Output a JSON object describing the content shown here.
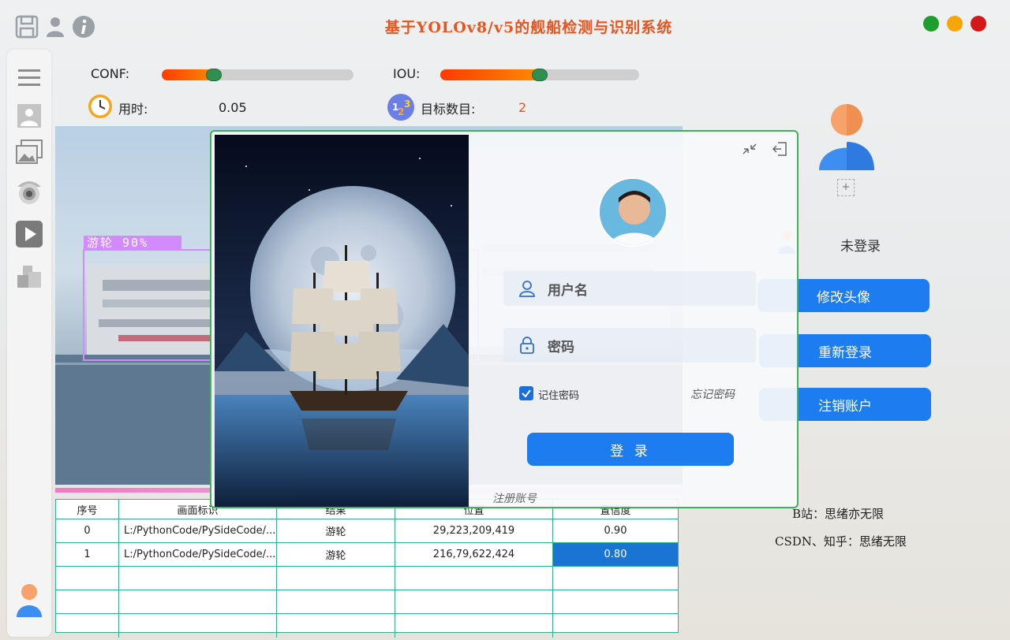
{
  "app": {
    "title": "基于YOLOv8/v5的舰船检测与识别系统",
    "colors": {
      "title": "#e8541e",
      "accent": "#1e7cf1",
      "green": "#1e9e2c",
      "orange": "#f6a609",
      "red": "#d21818"
    }
  },
  "toolbar": {
    "icons": [
      "save-icon",
      "user-icon",
      "info-icon"
    ]
  },
  "sidebar": {
    "items": [
      "menu-icon",
      "image-icon",
      "images-folder-icon",
      "camera-icon",
      "video-play-icon",
      "model-cube-icon",
      "avatar-icon"
    ]
  },
  "params": {
    "conf_label": "CONF:",
    "conf_value": 0.27,
    "iou_label": "IOU:",
    "iou_value": 0.5,
    "time_label": "用时:",
    "time_value": "0.05",
    "count_label": "目标数目:",
    "count_value": "2"
  },
  "detection": {
    "label": "游轮 90%"
  },
  "table": {
    "headers": [
      "序号",
      "画面标识",
      "结果",
      "位置",
      "置信度"
    ],
    "rows": [
      [
        "0",
        "L:/PythonCode/PySideCode/...",
        "游轮",
        "29,223,209,419",
        "0.90"
      ],
      [
        "1",
        "L:/PythonCode/PySideCode/...",
        "游轮",
        "216,79,622,424",
        "0.80"
      ]
    ],
    "empty_rows": 3
  },
  "right_panel": {
    "status": "未登录",
    "plus": "+",
    "change_avatar": "修改头像",
    "relogin": "重新登录",
    "cancel_account": "注销账户",
    "credit1": "B站：思绪亦无限",
    "credit2": "CSDN、知乎：思绪无限"
  },
  "login": {
    "username_placeholder": "用户名",
    "password_placeholder": "密码",
    "remember_label": "记住密码",
    "remember_checked": true,
    "forgot_label": "忘记密码",
    "login_button": "登 录",
    "register_link": "注册账号"
  }
}
